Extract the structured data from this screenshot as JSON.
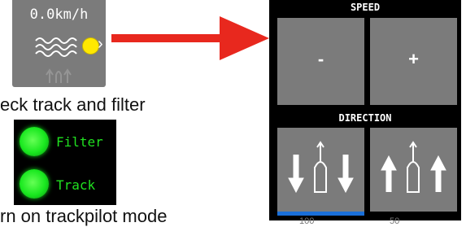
{
  "speed_tile": {
    "speed_value": "0.0km/h",
    "status_color": "#ffe800",
    "icons": [
      "waves-icon",
      "status-dot",
      "chevron-right-icon",
      "faint-direction-arrows-icon"
    ]
  },
  "captions": {
    "line1": "eck track and filter",
    "line2": "rn on trackpilot mode"
  },
  "indicators": [
    {
      "label": "Filter",
      "color": "#19e81f"
    },
    {
      "label": "Track",
      "color": "#19e81f"
    }
  ],
  "panel": {
    "speed_header": "SPEED",
    "minus_label": "-",
    "plus_label": "+",
    "direction_header": "DIRECTION",
    "direction_buttons": [
      {
        "icon": "direction-backward-icon",
        "active": true
      },
      {
        "icon": "direction-forward-icon",
        "active": false
      }
    ],
    "active_color": "#1a6fd8",
    "bottom_cut_text": [
      "100",
      "50"
    ]
  },
  "pointer_arrow_color": "#e8281e"
}
